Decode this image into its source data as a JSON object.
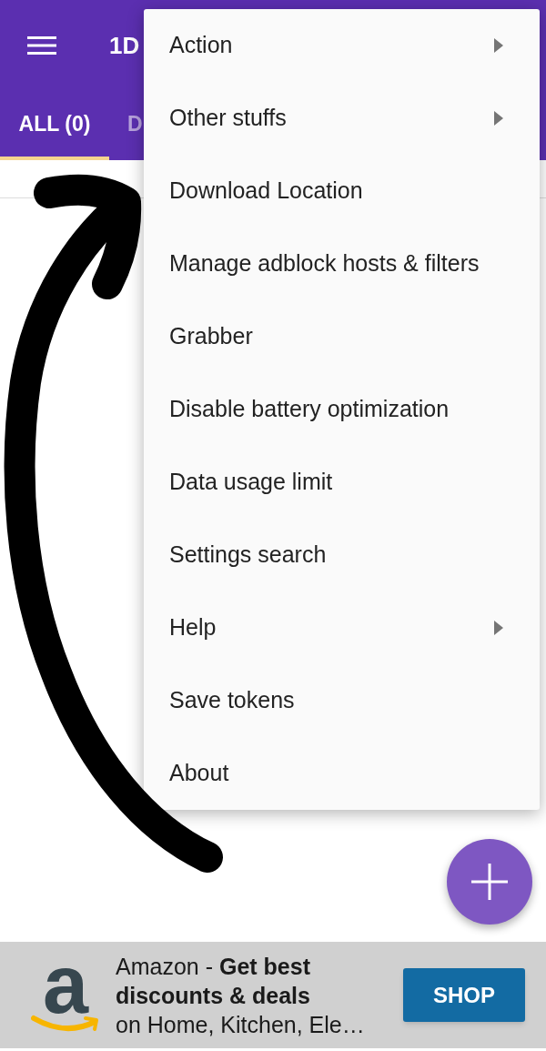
{
  "app_bar": {
    "title": "1D"
  },
  "tabs": [
    {
      "label": "ALL (0)",
      "selected": true
    },
    {
      "label": "D",
      "selected": false
    }
  ],
  "overflow_menu": {
    "items": [
      {
        "label": "Action",
        "has_submenu": true
      },
      {
        "label": "Other stuffs",
        "has_submenu": true
      },
      {
        "label": "Download Location",
        "has_submenu": false
      },
      {
        "label": "Manage adblock hosts & filters",
        "has_submenu": false
      },
      {
        "label": "Grabber",
        "has_submenu": false
      },
      {
        "label": "Disable battery optimization",
        "has_submenu": false
      },
      {
        "label": "Data usage limit",
        "has_submenu": false
      },
      {
        "label": "Settings search",
        "has_submenu": false
      },
      {
        "label": "Help",
        "has_submenu": true
      },
      {
        "label": "Save tokens",
        "has_submenu": false
      },
      {
        "label": "About",
        "has_submenu": false
      }
    ]
  },
  "ad_banner": {
    "logo_letter": "a",
    "headline": "Amazon - **Get best discounts & deals**",
    "description": "on Home, Kitchen, Ele…",
    "button": "SHOP"
  }
}
